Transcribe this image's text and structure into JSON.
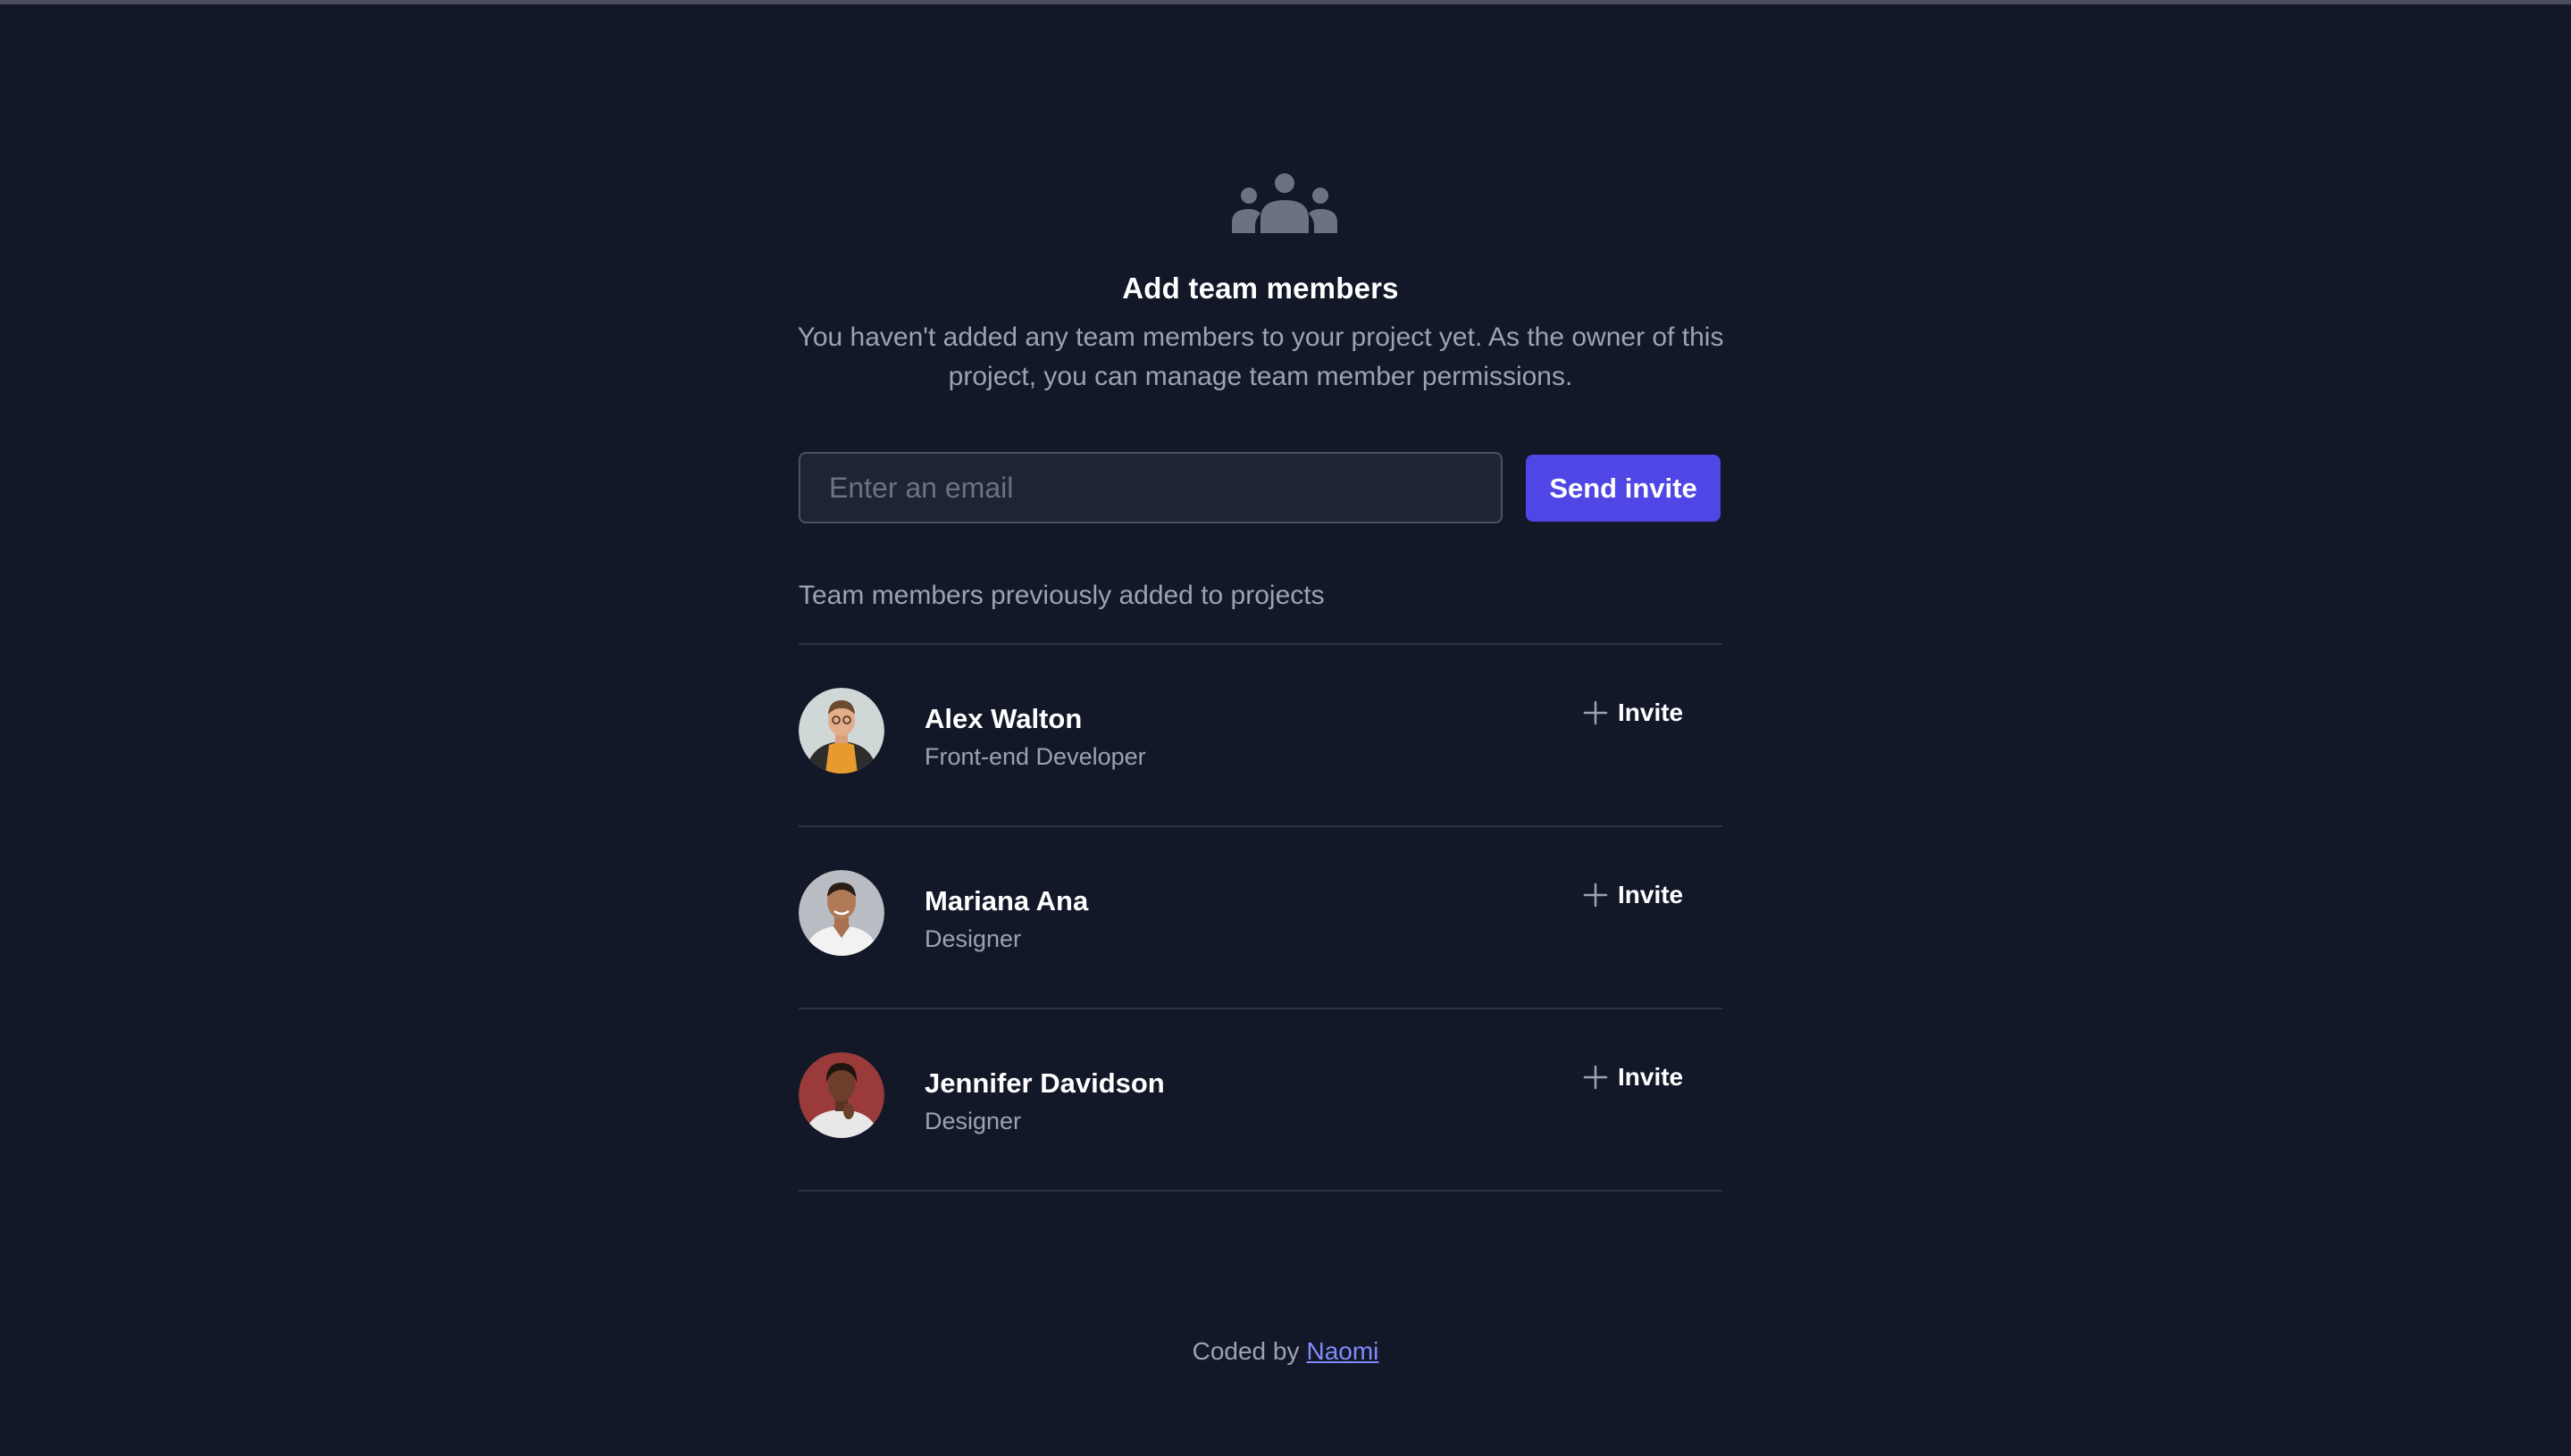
{
  "header": {
    "icon": "user-group-icon",
    "title": "Add team members",
    "description": "You haven't added any team members to your project yet. As the owner of this project, you can manage team member permissions."
  },
  "invite_form": {
    "email_placeholder": "Enter an email",
    "email_value": "",
    "send_label": "Send invite"
  },
  "members_section": {
    "heading": "Team members previously added to projects",
    "members": [
      {
        "name": "Alex Walton",
        "role": "Front-end Developer",
        "invite_label": "Invite",
        "invite_icon": "plus-icon"
      },
      {
        "name": "Mariana Ana",
        "role": "Designer",
        "invite_label": "Invite",
        "invite_icon": "plus-icon"
      },
      {
        "name": "Jennifer Davidson",
        "role": "Designer",
        "invite_label": "Invite",
        "invite_icon": "plus-icon"
      }
    ]
  },
  "footer": {
    "prefix": "Coded by",
    "link_label": "Naomi"
  },
  "colors": {
    "background": "#121828",
    "accent": "#4f46e5",
    "link": "#818cf8",
    "muted_text": "#9ca3af",
    "divider": "#2b3140"
  }
}
